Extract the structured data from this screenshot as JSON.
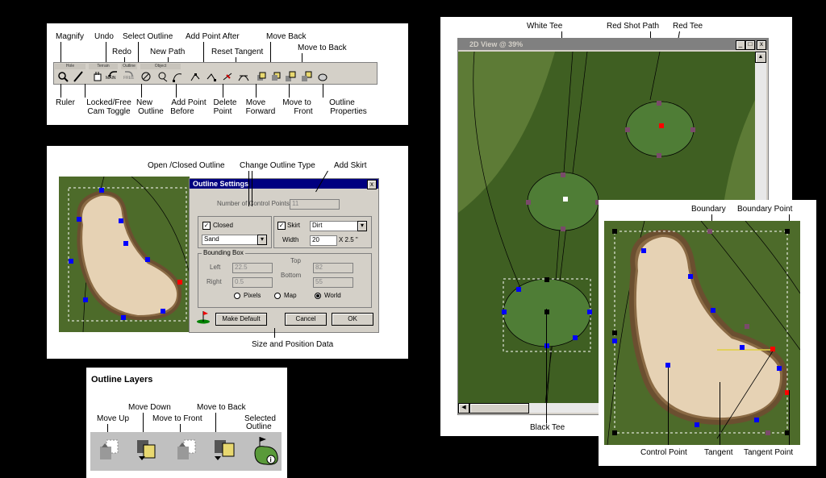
{
  "toolbar_panel": {
    "groups": [
      "Hole",
      "Terrain",
      "Outline",
      "Object"
    ],
    "callouts_top": [
      "Magnify",
      "Undo",
      "Redo",
      "Select Outline",
      "New Path",
      "Add Point After",
      "Reset Tangent",
      "Move Back",
      "Move to Back"
    ],
    "callouts_bottom": [
      "Ruler",
      "Locked/Free",
      "Cam Toggle",
      "New",
      "Outline",
      "Add Point",
      "Before",
      "Delete",
      "Point",
      "Move",
      "Forward",
      "Move  to",
      "Front",
      "Outline",
      "Properties"
    ],
    "button_text": [
      "MAIN",
      "FREE"
    ]
  },
  "settings_panel": {
    "callouts": [
      "Open /Closed Outline",
      "Change Outline Type",
      "Add Skirt",
      "Size and Position Data"
    ],
    "dialog": {
      "title": "Outline Settings",
      "close": "x",
      "num_points_label": "Number of Control Points:",
      "num_points_value": "11",
      "closed_label": "Closed",
      "type_value": "Sand",
      "skirt_label": "Skirt",
      "skirt_type": "Dirt",
      "width_label": "Width",
      "width_value": "20",
      "width_unit": "X 2.5 \"",
      "bbox_label": "Bounding Box",
      "left_label": "Left",
      "left_value": "22.5",
      "top_label": "Top",
      "top_value": "82",
      "right_label": "Right",
      "right_value": "0.5",
      "bottom_label": "Bottom",
      "bottom_value": "55",
      "units": [
        "Pixels",
        "Map",
        "World"
      ],
      "selected_unit": "World",
      "make_default": "Make Default",
      "cancel": "Cancel",
      "ok": "OK"
    }
  },
  "layers_panel": {
    "title": "Outline Layers",
    "callouts": [
      "Move Down",
      "Move to Back",
      "Move Up",
      "Move to Front",
      "Selected",
      "Outline"
    ]
  },
  "view_panel": {
    "window_title": "2D View @ 39%",
    "callouts": [
      "White Tee",
      "Red Shot Path",
      "Red Tee",
      "Black Tee"
    ]
  },
  "zoom_panel": {
    "callouts": [
      "Boundary",
      "Boundary Point",
      "Control Point",
      "Tangent",
      "Tangent Point"
    ]
  },
  "colors": {
    "control_point": "#0000ff",
    "tangent_point": "#ff0000",
    "boundary_point": "#000000",
    "grass": "#4d6b2a",
    "sand": "#e6d2b4",
    "toolbar": "#d4d0c8",
    "title_bar": "#000080"
  },
  "icons": [
    "magnify-icon",
    "ruler-icon",
    "hand-icon",
    "undo-icon",
    "redo-icon",
    "select-outline-icon",
    "new-outline-icon",
    "new-path-icon",
    "add-point-before-icon",
    "add-point-after-icon",
    "delete-point-icon",
    "reset-tangent-icon",
    "move-forward-icon",
    "move-back-icon",
    "move-to-front-icon",
    "move-to-back-icon",
    "outline-properties-icon"
  ]
}
